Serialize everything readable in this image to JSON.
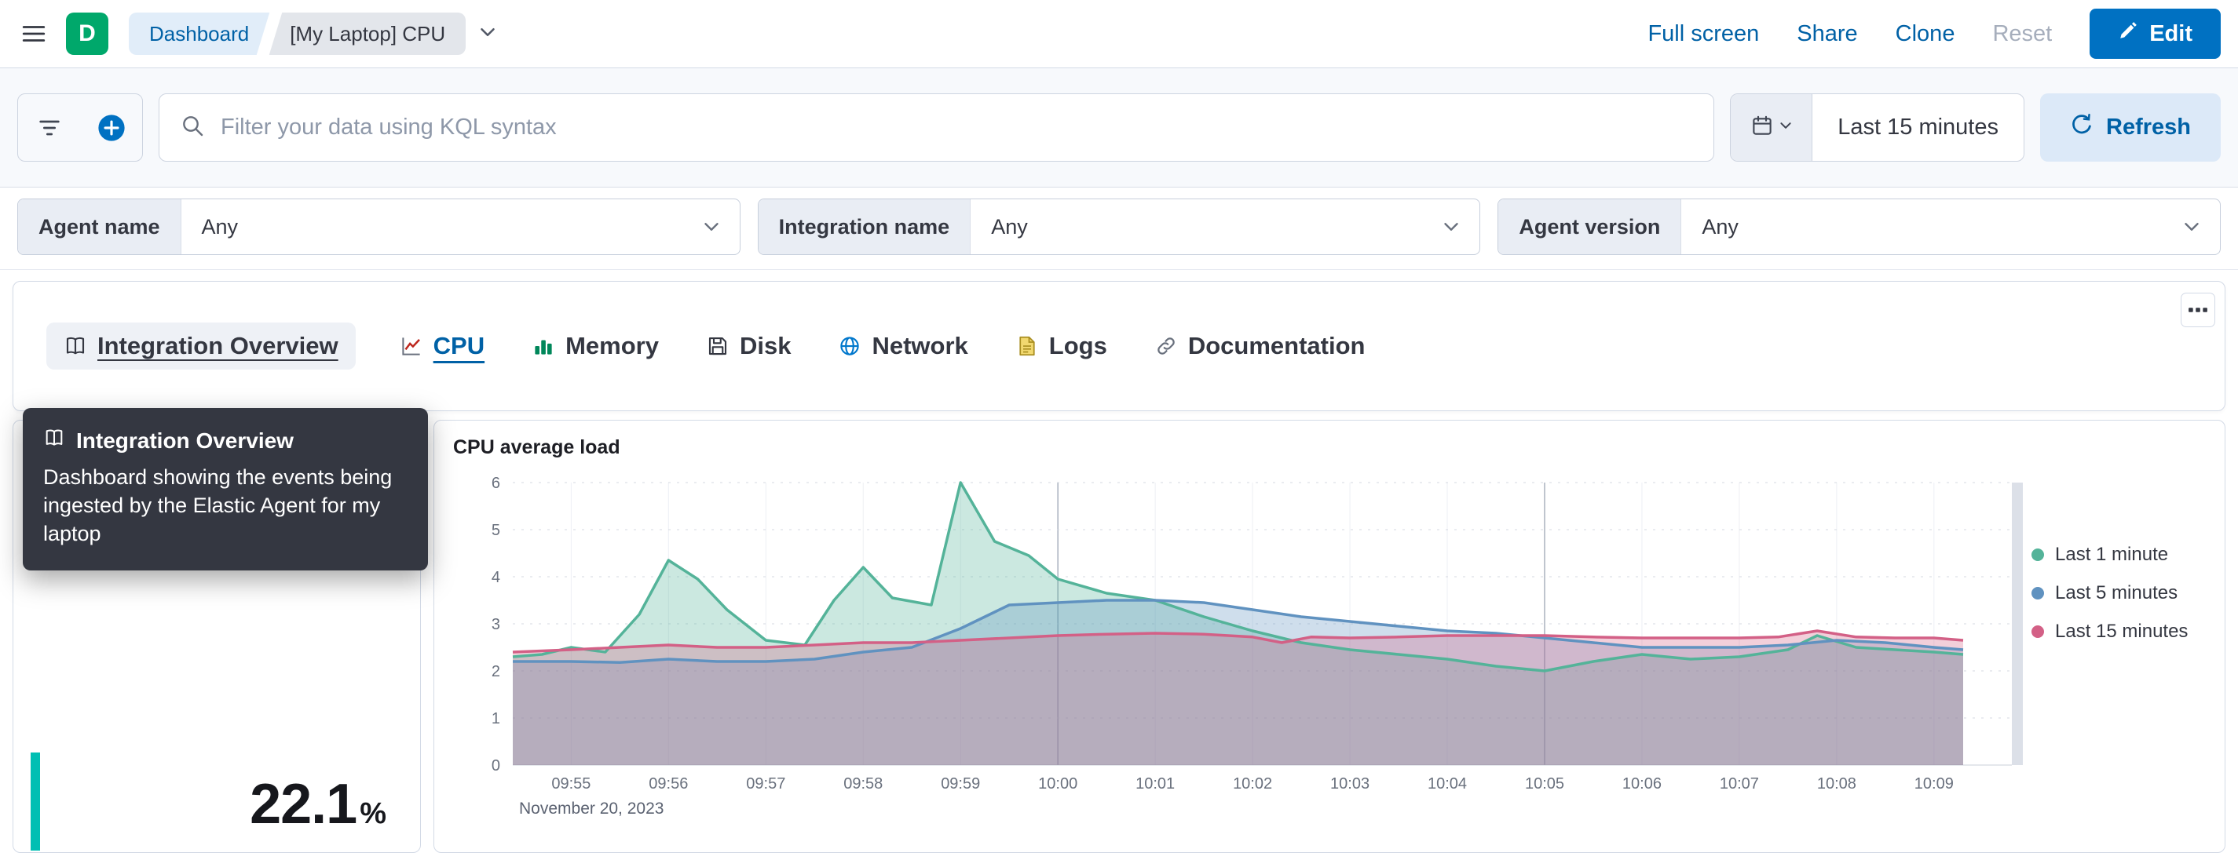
{
  "header": {
    "logo_letter": "D",
    "logo_color": "#00A86B",
    "breadcrumbs": [
      "Dashboard",
      "[My Laptop] CPU"
    ],
    "actions": {
      "full_screen": "Full screen",
      "share": "Share",
      "clone": "Clone",
      "reset": "Reset",
      "edit": "Edit"
    }
  },
  "query_bar": {
    "search_placeholder": "Filter your data using KQL syntax",
    "time_range": "Last 15 minutes",
    "refresh_label": "Refresh"
  },
  "filters": [
    {
      "label": "Agent name",
      "value": "Any"
    },
    {
      "label": "Integration name",
      "value": "Any"
    },
    {
      "label": "Agent version",
      "value": "Any"
    }
  ],
  "nav": {
    "items": [
      {
        "label": "Integration Overview",
        "icon": "book-icon",
        "state": "hover"
      },
      {
        "label": "CPU",
        "icon": "line-chart-icon",
        "state": "active"
      },
      {
        "label": "Memory",
        "icon": "bar-chart-icon",
        "state": ""
      },
      {
        "label": "Disk",
        "icon": "disk-icon",
        "state": ""
      },
      {
        "label": "Network",
        "icon": "globe-icon",
        "state": ""
      },
      {
        "label": "Logs",
        "icon": "document-icon",
        "state": ""
      },
      {
        "label": "Documentation",
        "icon": "link-icon",
        "state": ""
      }
    ]
  },
  "tooltip": {
    "title": "Integration Overview",
    "body": "Dashboard showing the events being ingested by the Elastic Agent for my laptop"
  },
  "metric": {
    "value": "22.1",
    "unit": "%",
    "accent_color": "#00BFB3"
  },
  "chart_data": {
    "type": "area",
    "title": "CPU average load",
    "date_label": "November 20, 2023",
    "x_tick_labels": [
      "09:55",
      "09:56",
      "09:57",
      "09:58",
      "09:59",
      "10:00",
      "10:01",
      "10:02",
      "10:03",
      "10:04",
      "10:05",
      "10:06",
      "10:07",
      "10:08",
      "10:09"
    ],
    "x_domain": [
      -0.6,
      14.8
    ],
    "ylim": [
      0,
      6
    ],
    "y_ticks": [
      0,
      1,
      2,
      3,
      4,
      5,
      6
    ],
    "emphasized_x_ticks": [
      5,
      10
    ],
    "grid": true,
    "legend_position": "right",
    "series": [
      {
        "name": "Last 1 minute",
        "color": "#54B399",
        "points": [
          [
            -0.6,
            2.3
          ],
          [
            -0.3,
            2.35
          ],
          [
            0,
            2.5
          ],
          [
            0.35,
            2.4
          ],
          [
            0.7,
            3.2
          ],
          [
            1,
            4.35
          ],
          [
            1.3,
            3.95
          ],
          [
            1.6,
            3.3
          ],
          [
            2,
            2.65
          ],
          [
            2.4,
            2.55
          ],
          [
            2.7,
            3.5
          ],
          [
            3,
            4.2
          ],
          [
            3.3,
            3.55
          ],
          [
            3.7,
            3.4
          ],
          [
            4,
            6.0
          ],
          [
            4.35,
            4.75
          ],
          [
            4.7,
            4.45
          ],
          [
            5,
            3.95
          ],
          [
            5.5,
            3.65
          ],
          [
            6,
            3.5
          ],
          [
            6.5,
            3.15
          ],
          [
            7,
            2.85
          ],
          [
            7.5,
            2.6
          ],
          [
            8,
            2.45
          ],
          [
            8.5,
            2.35
          ],
          [
            9,
            2.25
          ],
          [
            9.5,
            2.1
          ],
          [
            10,
            2.0
          ],
          [
            10.5,
            2.2
          ],
          [
            11,
            2.35
          ],
          [
            11.5,
            2.25
          ],
          [
            12,
            2.3
          ],
          [
            12.5,
            2.45
          ],
          [
            12.8,
            2.75
          ],
          [
            13.2,
            2.5
          ],
          [
            13.6,
            2.45
          ],
          [
            14,
            2.4
          ],
          [
            14.3,
            2.35
          ]
        ]
      },
      {
        "name": "Last 5 minutes",
        "color": "#6092C0",
        "points": [
          [
            -0.6,
            2.2
          ],
          [
            0,
            2.2
          ],
          [
            0.5,
            2.18
          ],
          [
            1,
            2.25
          ],
          [
            1.5,
            2.2
          ],
          [
            2,
            2.2
          ],
          [
            2.5,
            2.25
          ],
          [
            3,
            2.4
          ],
          [
            3.5,
            2.5
          ],
          [
            4,
            2.9
          ],
          [
            4.5,
            3.4
          ],
          [
            5,
            3.45
          ],
          [
            5.5,
            3.5
          ],
          [
            6,
            3.5
          ],
          [
            6.5,
            3.45
          ],
          [
            7,
            3.3
          ],
          [
            7.5,
            3.15
          ],
          [
            8,
            3.05
          ],
          [
            8.5,
            2.95
          ],
          [
            9,
            2.85
          ],
          [
            9.5,
            2.8
          ],
          [
            10,
            2.7
          ],
          [
            10.5,
            2.6
          ],
          [
            11,
            2.5
          ],
          [
            11.5,
            2.5
          ],
          [
            12,
            2.5
          ],
          [
            12.5,
            2.55
          ],
          [
            13,
            2.65
          ],
          [
            13.5,
            2.6
          ],
          [
            14,
            2.5
          ],
          [
            14.3,
            2.45
          ]
        ]
      },
      {
        "name": "Last 15 minutes",
        "color": "#D36086",
        "points": [
          [
            -0.6,
            2.4
          ],
          [
            0,
            2.45
          ],
          [
            0.5,
            2.5
          ],
          [
            1,
            2.55
          ],
          [
            1.5,
            2.5
          ],
          [
            2,
            2.5
          ],
          [
            2.5,
            2.55
          ],
          [
            3,
            2.6
          ],
          [
            3.5,
            2.6
          ],
          [
            4,
            2.65
          ],
          [
            4.5,
            2.7
          ],
          [
            5,
            2.75
          ],
          [
            5.5,
            2.78
          ],
          [
            6,
            2.8
          ],
          [
            6.5,
            2.78
          ],
          [
            7,
            2.72
          ],
          [
            7.3,
            2.6
          ],
          [
            7.6,
            2.72
          ],
          [
            8,
            2.7
          ],
          [
            8.5,
            2.72
          ],
          [
            9,
            2.75
          ],
          [
            9.5,
            2.75
          ],
          [
            10,
            2.75
          ],
          [
            10.5,
            2.72
          ],
          [
            11,
            2.7
          ],
          [
            11.5,
            2.7
          ],
          [
            12,
            2.7
          ],
          [
            12.4,
            2.72
          ],
          [
            12.8,
            2.85
          ],
          [
            13.2,
            2.72
          ],
          [
            13.6,
            2.7
          ],
          [
            14,
            2.7
          ],
          [
            14.3,
            2.65
          ]
        ]
      }
    ]
  }
}
